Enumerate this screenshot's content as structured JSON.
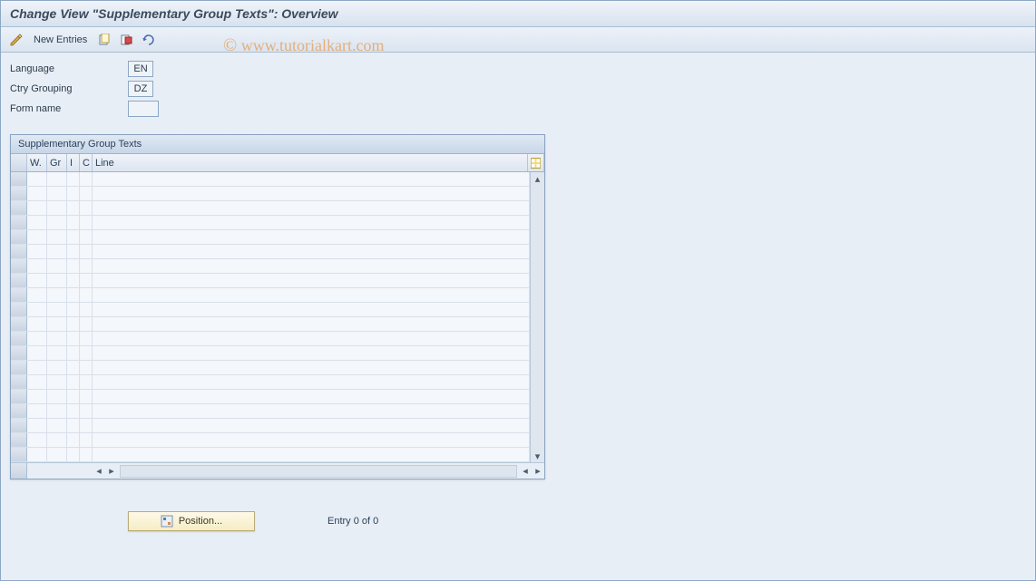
{
  "title": "Change View \"Supplementary Group Texts\": Overview",
  "toolbar": {
    "new_entries": "New Entries"
  },
  "form": {
    "language_label": "Language",
    "language_value": "EN",
    "ctry_label": "Ctry Grouping",
    "ctry_value": "DZ",
    "form_name_label": "Form name",
    "form_name_value": ""
  },
  "table": {
    "title": "Supplementary Group Texts",
    "cols": {
      "w": "W.",
      "gr": "Gr",
      "i": "I",
      "c": "C",
      "line": "Line"
    }
  },
  "position_btn": "Position...",
  "entry_status": "Entry 0 of 0",
  "watermark": "www.tutorialkart.com"
}
